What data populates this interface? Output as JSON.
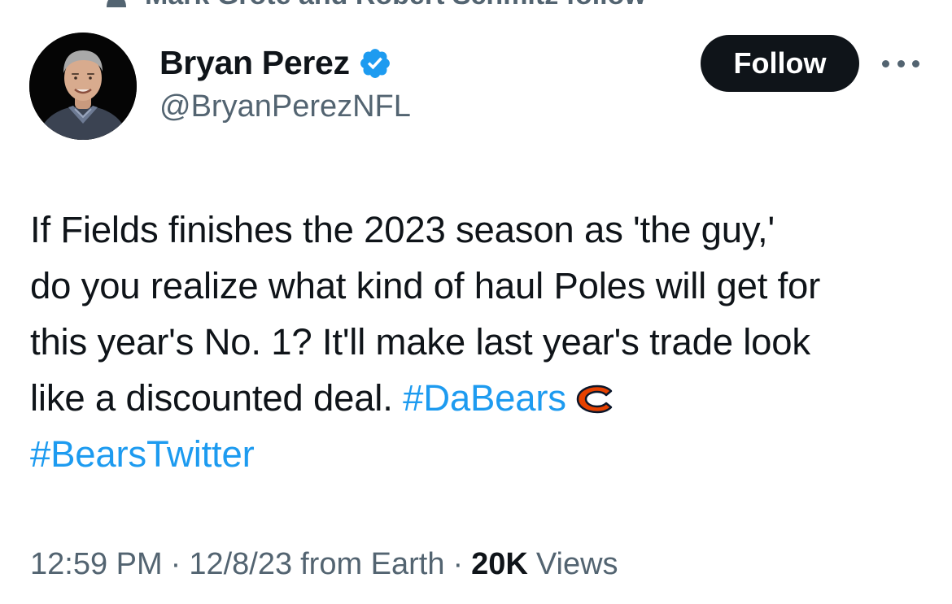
{
  "social_context": {
    "text": "Mark Grote and Robert Schmitz follow"
  },
  "author": {
    "name": "Bryan Perez",
    "handle": "@BryanPerezNFL",
    "verified": true
  },
  "actions": {
    "follow_label": "Follow"
  },
  "tweet": {
    "lines": [
      "If Fields finishes the 2023 season as 'the guy,'",
      "do you realize what kind of haul Poles will get for",
      "this year's No. 1? It'll make last year's trade look"
    ],
    "line4_text": "like a discounted deal. ",
    "hashtag_1": "#DaBears",
    "hashtag_2": "#BearsTwitter",
    "emoji": "chicago-bears-logo-icon"
  },
  "meta": {
    "time": "12:59 PM",
    "date": "12/8/23",
    "source": "from Earth",
    "views_count": "20K",
    "views_label": "Views",
    "separator": "·"
  },
  "colors": {
    "text_primary": "#0f1419",
    "text_secondary": "#536471",
    "link": "#1d9bf0",
    "verified": "#1d9bf0",
    "follow_bg": "#0f1419",
    "bears_orange": "#e64100",
    "bears_navy": "#0b162a"
  }
}
